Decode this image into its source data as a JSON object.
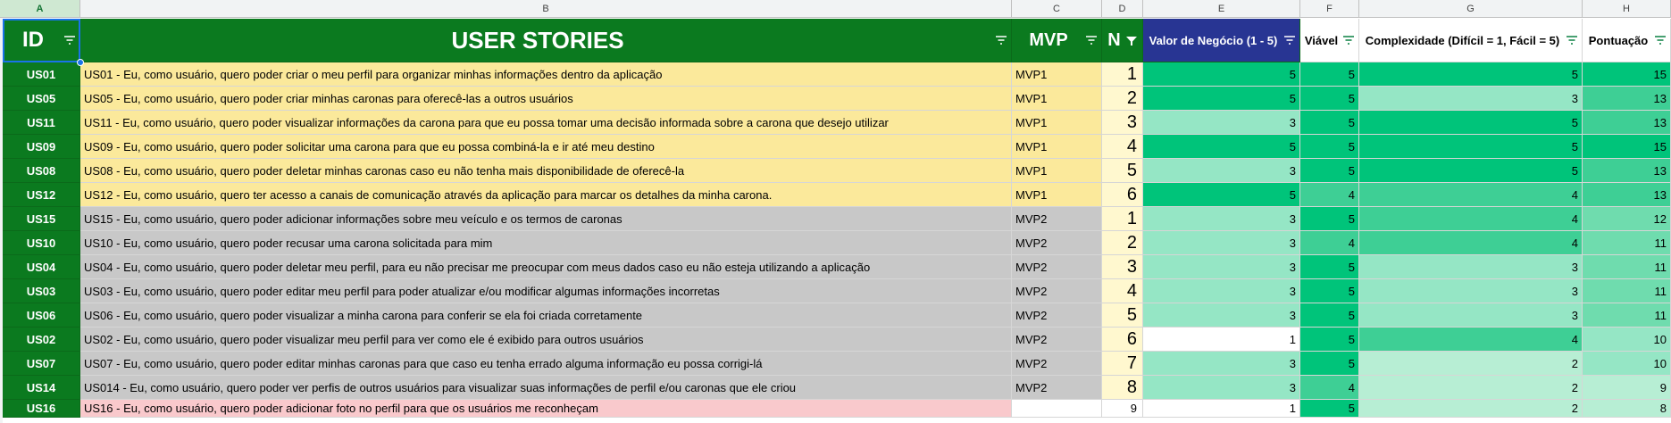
{
  "colors": {
    "header_green": "#0b7a1f",
    "header_navy": "#283593",
    "mvp1_row": "#fbe99b",
    "mvp2_row": "#c8c8c8",
    "backlog_row": "#f9c9cc",
    "n_cell": "#fff8cf",
    "selection": "#1a73e8",
    "scale": [
      "#ffffff",
      "#d7f5e6",
      "#b7eed4",
      "#95e6c5",
      "#6fdcae",
      "#3ecf95",
      "#00c47a"
    ]
  },
  "column_letters": [
    "A",
    "B",
    "C",
    "D",
    "E",
    "F",
    "G",
    "H"
  ],
  "headers": {
    "id": "ID",
    "stories": "USER STORIES",
    "mvp": "MVP",
    "n": "N",
    "valor": "Valor de Negócio (1 - 5)",
    "viavel": "Viável",
    "complexidade": "Complexidade (Difícil = 1, Fácil = 5)",
    "pontuacao": "Pontuação"
  },
  "icons": {
    "filter": "filter-icon",
    "filter_active": "filter-active-icon"
  },
  "rows": [
    {
      "id": "US01",
      "story": "US01 - Eu, como usuário, quero poder criar o meu perfil para organizar minhas informações dentro da aplicação",
      "mvp": "MVP1",
      "n": "1",
      "valor": 5,
      "viavel": 5,
      "complexidade": 5,
      "pontuacao": 15,
      "group": "mvp1"
    },
    {
      "id": "US05",
      "story": "US05 - Eu, como usuário, quero poder criar minhas caronas para oferecê-las a outros usuários",
      "mvp": "MVP1",
      "n": "2",
      "valor": 5,
      "viavel": 5,
      "complexidade": 3,
      "pontuacao": 13,
      "group": "mvp1"
    },
    {
      "id": "US11",
      "story": "US11 - Eu, como usuário, quero poder visualizar informações da carona para que eu possa tomar uma decisão informada sobre a carona que desejo utilizar",
      "mvp": "MVP1",
      "n": "3",
      "valor": 3,
      "viavel": 5,
      "complexidade": 5,
      "pontuacao": 13,
      "group": "mvp1"
    },
    {
      "id": "US09",
      "story": "US09 - Eu, como usuário, quero poder solicitar uma carona para que eu possa combiná-la e ir até meu destino",
      "mvp": "MVP1",
      "n": "4",
      "valor": 5,
      "viavel": 5,
      "complexidade": 5,
      "pontuacao": 15,
      "group": "mvp1"
    },
    {
      "id": "US08",
      "story": "US08 - Eu, como usuário, quero poder deletar minhas caronas caso eu não tenha mais disponibilidade de oferecê-la",
      "mvp": "MVP1",
      "n": "5",
      "valor": 3,
      "viavel": 5,
      "complexidade": 5,
      "pontuacao": 13,
      "group": "mvp1"
    },
    {
      "id": "US12",
      "story": "US12 - Eu, como usuário, quero ter acesso a canais de comunicação através da aplicação para marcar os detalhes da minha carona.",
      "mvp": "MVP1",
      "n": "6",
      "valor": 5,
      "viavel": 4,
      "complexidade": 4,
      "pontuacao": 13,
      "group": "mvp1"
    },
    {
      "id": "US15",
      "story": "US15 - Eu, como usuário, quero poder adicionar informações sobre meu veículo e os termos de caronas",
      "mvp": "MVP2",
      "n": "1",
      "valor": 3,
      "viavel": 5,
      "complexidade": 4,
      "pontuacao": 12,
      "group": "mvp2"
    },
    {
      "id": "US10",
      "story": "US10 - Eu, como usuário, quero poder recusar uma carona solicitada para mim",
      "mvp": "MVP2",
      "n": "2",
      "valor": 3,
      "viavel": 4,
      "complexidade": 4,
      "pontuacao": 11,
      "group": "mvp2"
    },
    {
      "id": "US04",
      "story": "US04 - Eu, como usuário, quero poder deletar meu perfil, para eu não precisar me preocupar com meus dados caso eu não esteja utilizando a aplicação",
      "mvp": "MVP2",
      "n": "3",
      "valor": 3,
      "viavel": 5,
      "complexidade": 3,
      "pontuacao": 11,
      "group": "mvp2"
    },
    {
      "id": "US03",
      "story": "US03 - Eu, como usuário, quero poder editar meu perfil para poder atualizar e/ou modificar algumas informações incorretas",
      "mvp": "MVP2",
      "n": "4",
      "valor": 3,
      "viavel": 5,
      "complexidade": 3,
      "pontuacao": 11,
      "group": "mvp2"
    },
    {
      "id": "US06",
      "story": "US06 - Eu, como usuário, quero poder visualizar a minha carona para conferir se ela foi criada corretamente",
      "mvp": "MVP2",
      "n": "5",
      "valor": 3,
      "viavel": 5,
      "complexidade": 3,
      "pontuacao": 11,
      "group": "mvp2"
    },
    {
      "id": "US02",
      "story": "US02 - Eu, como usuário, quero poder visualizar meu perfil para ver como ele é exibido para outros usuários",
      "mvp": "MVP2",
      "n": "6",
      "valor": 1,
      "viavel": 5,
      "complexidade": 4,
      "pontuacao": 10,
      "group": "mvp2"
    },
    {
      "id": "US07",
      "story": "US07 - Eu, como usuário, quero poder editar minhas caronas para que caso eu tenha errado alguma informação eu possa corrigi-lá",
      "mvp": "MVP2",
      "n": "7",
      "valor": 3,
      "viavel": 5,
      "complexidade": 2,
      "pontuacao": 10,
      "group": "mvp2"
    },
    {
      "id": "US14",
      "story": "US014 - Eu, como usuário, quero poder ver perfis de outros usuários para visualizar suas informações de perfil e/ou caronas que ele criou",
      "mvp": "MVP2",
      "n": "8",
      "valor": 3,
      "viavel": 4,
      "complexidade": 2,
      "pontuacao": 9,
      "group": "mvp2"
    },
    {
      "id": "US16",
      "story": "US16 - Eu, como usuário, quero poder adicionar foto no perfil para que os usuários me reconheçam",
      "mvp": "",
      "n": "9",
      "valor": 1,
      "viavel": 5,
      "complexidade": 2,
      "pontuacao": 8,
      "group": "backlog"
    }
  ]
}
